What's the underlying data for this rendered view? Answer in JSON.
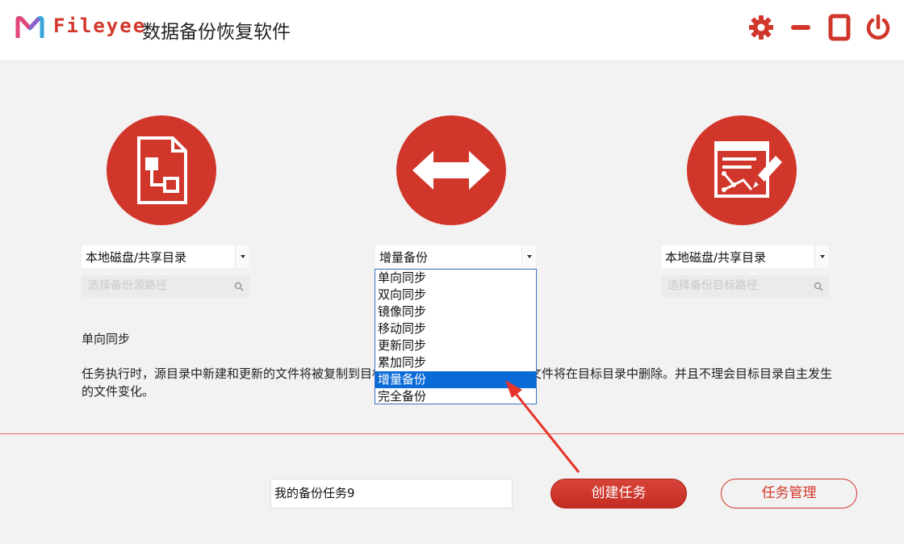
{
  "header": {
    "brand": "Fileyee",
    "title": "数据备份恢复软件"
  },
  "source": {
    "select_value": "本地磁盘/共享目录",
    "path_placeholder": "选择备份源路径"
  },
  "mode": {
    "select_value": "增量备份",
    "options": [
      "单向同步",
      "双向同步",
      "镜像同步",
      "移动同步",
      "更新同步",
      "累加同步",
      "增量备份",
      "完全备份"
    ],
    "selected_index": 6
  },
  "target": {
    "select_value": "本地磁盘/共享目录",
    "path_placeholder": "选择备份目标路径"
  },
  "description": {
    "title": "单向同步",
    "text": "任务执行时，源目录中新建和更新的文件将被复制到目标目录，源目录中已经删除的文件将在目标目录中删除。并且不理会目标目录自主发生的文件变化。"
  },
  "footer": {
    "task_name": "我的备份任务9",
    "create_button": "创建任务",
    "manage_button": "任务管理"
  },
  "colors": {
    "accent": "#d1362b",
    "selection": "#0a6ad6"
  }
}
